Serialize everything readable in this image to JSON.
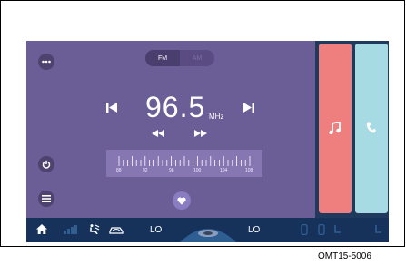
{
  "radio": {
    "band_fm": "FM",
    "band_am": "AM",
    "frequency": "96.5",
    "unit": "MHz",
    "dial_labels": [
      "88",
      "92",
      "96",
      "100",
      "104",
      "108"
    ]
  },
  "climate": {
    "left_temp": "LO",
    "right_temp": "LO"
  },
  "caption": "OMT15-5006",
  "colors": {
    "radio_bg": "#6b5d96",
    "music_card": "#ef7e7e",
    "phone_card": "#a6dbe3",
    "bottom_bar": "#16325a"
  },
  "icons": {
    "more": "more-icon",
    "power": "power-icon",
    "list": "list-icon",
    "prev": "skip-previous-icon",
    "next": "skip-next-icon",
    "seek_back": "seek-back-icon",
    "seek_fwd": "seek-forward-icon",
    "favorite": "heart-icon",
    "music": "music-note-icon",
    "phone": "phone-icon",
    "home": "home-icon"
  }
}
